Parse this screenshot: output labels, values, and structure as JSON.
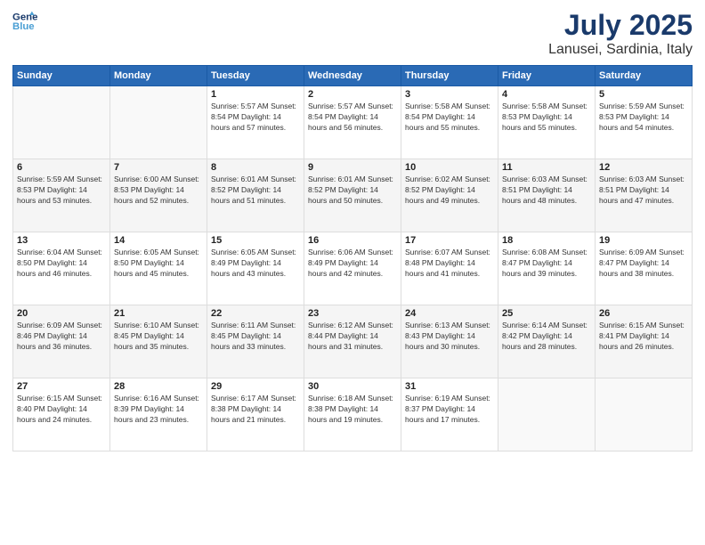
{
  "header": {
    "logo_line1": "General",
    "logo_line2": "Blue",
    "title": "July 2025",
    "subtitle": "Lanusei, Sardinia, Italy"
  },
  "weekdays": [
    "Sunday",
    "Monday",
    "Tuesday",
    "Wednesday",
    "Thursday",
    "Friday",
    "Saturday"
  ],
  "weeks": [
    [
      {
        "day": "",
        "info": ""
      },
      {
        "day": "",
        "info": ""
      },
      {
        "day": "1",
        "info": "Sunrise: 5:57 AM\nSunset: 8:54 PM\nDaylight: 14 hours and 57 minutes."
      },
      {
        "day": "2",
        "info": "Sunrise: 5:57 AM\nSunset: 8:54 PM\nDaylight: 14 hours and 56 minutes."
      },
      {
        "day": "3",
        "info": "Sunrise: 5:58 AM\nSunset: 8:54 PM\nDaylight: 14 hours and 55 minutes."
      },
      {
        "day": "4",
        "info": "Sunrise: 5:58 AM\nSunset: 8:53 PM\nDaylight: 14 hours and 55 minutes."
      },
      {
        "day": "5",
        "info": "Sunrise: 5:59 AM\nSunset: 8:53 PM\nDaylight: 14 hours and 54 minutes."
      }
    ],
    [
      {
        "day": "6",
        "info": "Sunrise: 5:59 AM\nSunset: 8:53 PM\nDaylight: 14 hours and 53 minutes."
      },
      {
        "day": "7",
        "info": "Sunrise: 6:00 AM\nSunset: 8:53 PM\nDaylight: 14 hours and 52 minutes."
      },
      {
        "day": "8",
        "info": "Sunrise: 6:01 AM\nSunset: 8:52 PM\nDaylight: 14 hours and 51 minutes."
      },
      {
        "day": "9",
        "info": "Sunrise: 6:01 AM\nSunset: 8:52 PM\nDaylight: 14 hours and 50 minutes."
      },
      {
        "day": "10",
        "info": "Sunrise: 6:02 AM\nSunset: 8:52 PM\nDaylight: 14 hours and 49 minutes."
      },
      {
        "day": "11",
        "info": "Sunrise: 6:03 AM\nSunset: 8:51 PM\nDaylight: 14 hours and 48 minutes."
      },
      {
        "day": "12",
        "info": "Sunrise: 6:03 AM\nSunset: 8:51 PM\nDaylight: 14 hours and 47 minutes."
      }
    ],
    [
      {
        "day": "13",
        "info": "Sunrise: 6:04 AM\nSunset: 8:50 PM\nDaylight: 14 hours and 46 minutes."
      },
      {
        "day": "14",
        "info": "Sunrise: 6:05 AM\nSunset: 8:50 PM\nDaylight: 14 hours and 45 minutes."
      },
      {
        "day": "15",
        "info": "Sunrise: 6:05 AM\nSunset: 8:49 PM\nDaylight: 14 hours and 43 minutes."
      },
      {
        "day": "16",
        "info": "Sunrise: 6:06 AM\nSunset: 8:49 PM\nDaylight: 14 hours and 42 minutes."
      },
      {
        "day": "17",
        "info": "Sunrise: 6:07 AM\nSunset: 8:48 PM\nDaylight: 14 hours and 41 minutes."
      },
      {
        "day": "18",
        "info": "Sunrise: 6:08 AM\nSunset: 8:47 PM\nDaylight: 14 hours and 39 minutes."
      },
      {
        "day": "19",
        "info": "Sunrise: 6:09 AM\nSunset: 8:47 PM\nDaylight: 14 hours and 38 minutes."
      }
    ],
    [
      {
        "day": "20",
        "info": "Sunrise: 6:09 AM\nSunset: 8:46 PM\nDaylight: 14 hours and 36 minutes."
      },
      {
        "day": "21",
        "info": "Sunrise: 6:10 AM\nSunset: 8:45 PM\nDaylight: 14 hours and 35 minutes."
      },
      {
        "day": "22",
        "info": "Sunrise: 6:11 AM\nSunset: 8:45 PM\nDaylight: 14 hours and 33 minutes."
      },
      {
        "day": "23",
        "info": "Sunrise: 6:12 AM\nSunset: 8:44 PM\nDaylight: 14 hours and 31 minutes."
      },
      {
        "day": "24",
        "info": "Sunrise: 6:13 AM\nSunset: 8:43 PM\nDaylight: 14 hours and 30 minutes."
      },
      {
        "day": "25",
        "info": "Sunrise: 6:14 AM\nSunset: 8:42 PM\nDaylight: 14 hours and 28 minutes."
      },
      {
        "day": "26",
        "info": "Sunrise: 6:15 AM\nSunset: 8:41 PM\nDaylight: 14 hours and 26 minutes."
      }
    ],
    [
      {
        "day": "27",
        "info": "Sunrise: 6:15 AM\nSunset: 8:40 PM\nDaylight: 14 hours and 24 minutes."
      },
      {
        "day": "28",
        "info": "Sunrise: 6:16 AM\nSunset: 8:39 PM\nDaylight: 14 hours and 23 minutes."
      },
      {
        "day": "29",
        "info": "Sunrise: 6:17 AM\nSunset: 8:38 PM\nDaylight: 14 hours and 21 minutes."
      },
      {
        "day": "30",
        "info": "Sunrise: 6:18 AM\nSunset: 8:38 PM\nDaylight: 14 hours and 19 minutes."
      },
      {
        "day": "31",
        "info": "Sunrise: 6:19 AM\nSunset: 8:37 PM\nDaylight: 14 hours and 17 minutes."
      },
      {
        "day": "",
        "info": ""
      },
      {
        "day": "",
        "info": ""
      }
    ]
  ]
}
